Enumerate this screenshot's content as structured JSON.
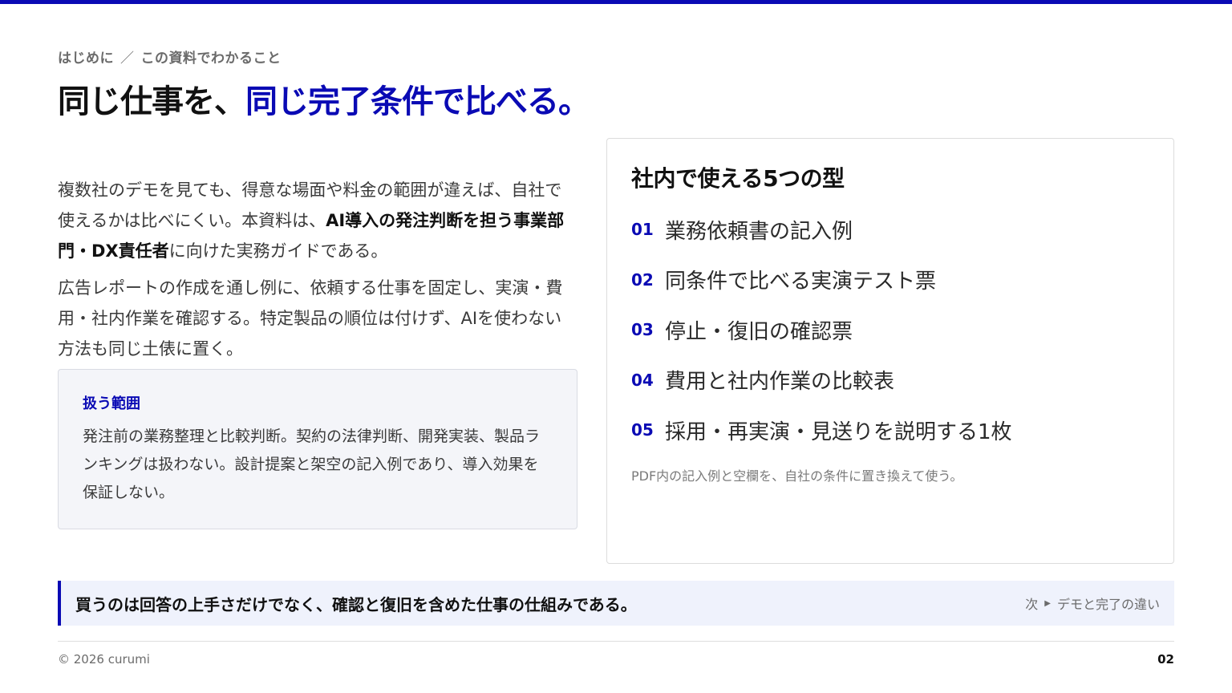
{
  "breadcrumb": {
    "section": "はじめに",
    "separator": "／",
    "page": "この資料でわかること"
  },
  "title": {
    "plain": "同じ仕事を、",
    "accent": "同じ完了条件で比べる。"
  },
  "intro": {
    "p1_a": "複数社のデモを見ても、得意な場面や料金の範囲が違えば、自社で使えるかは比べにくい。本資料は、",
    "p1_bold": "AI導入の発注判断を担う事業部門・DX責任者",
    "p1_b": "に向けた実務ガイドである。",
    "p2": "広告レポートの作成を通し例に、依頼する仕事を固定し、実演・費用・社内作業を確認する。特定製品の順位は付けず、AIを使わない方法も同じ土俵に置く。"
  },
  "scope": {
    "title": "扱う範囲",
    "text": "発注前の業務整理と比較判断。契約の法律判断、開発実装、製品ランキングは扱わない。設計提案と架空の記入例であり、導入効果を保証しない。"
  },
  "types": {
    "title": "社内で使える5つの型",
    "items": [
      {
        "num": "01",
        "label": "業務依頼書の記入例"
      },
      {
        "num": "02",
        "label": "同条件で比べる実演テスト票"
      },
      {
        "num": "03",
        "label": "停止・復旧の確認票"
      },
      {
        "num": "04",
        "label": "費用と社内作業の比較表"
      },
      {
        "num": "05",
        "label": "採用・再実演・見送りを説明する1枚"
      }
    ],
    "note": "PDF内の記入例と空欄を、自社の条件に置き換えて使う。"
  },
  "callout": {
    "text": "買うのは回答の上手さだけでなく、確認と復旧を含めた仕事の仕組みである。",
    "next_prefix": "次",
    "next_label": "デモと完了の違い"
  },
  "footer": {
    "copyright": "© 2026 curumi",
    "page_number": "02"
  },
  "colors": {
    "accent": "#0a0ab4",
    "callout_bg": "#eff2fc",
    "scope_bg": "#f4f5f9"
  },
  "icons": {
    "next_arrow": "triangle-right-icon"
  }
}
